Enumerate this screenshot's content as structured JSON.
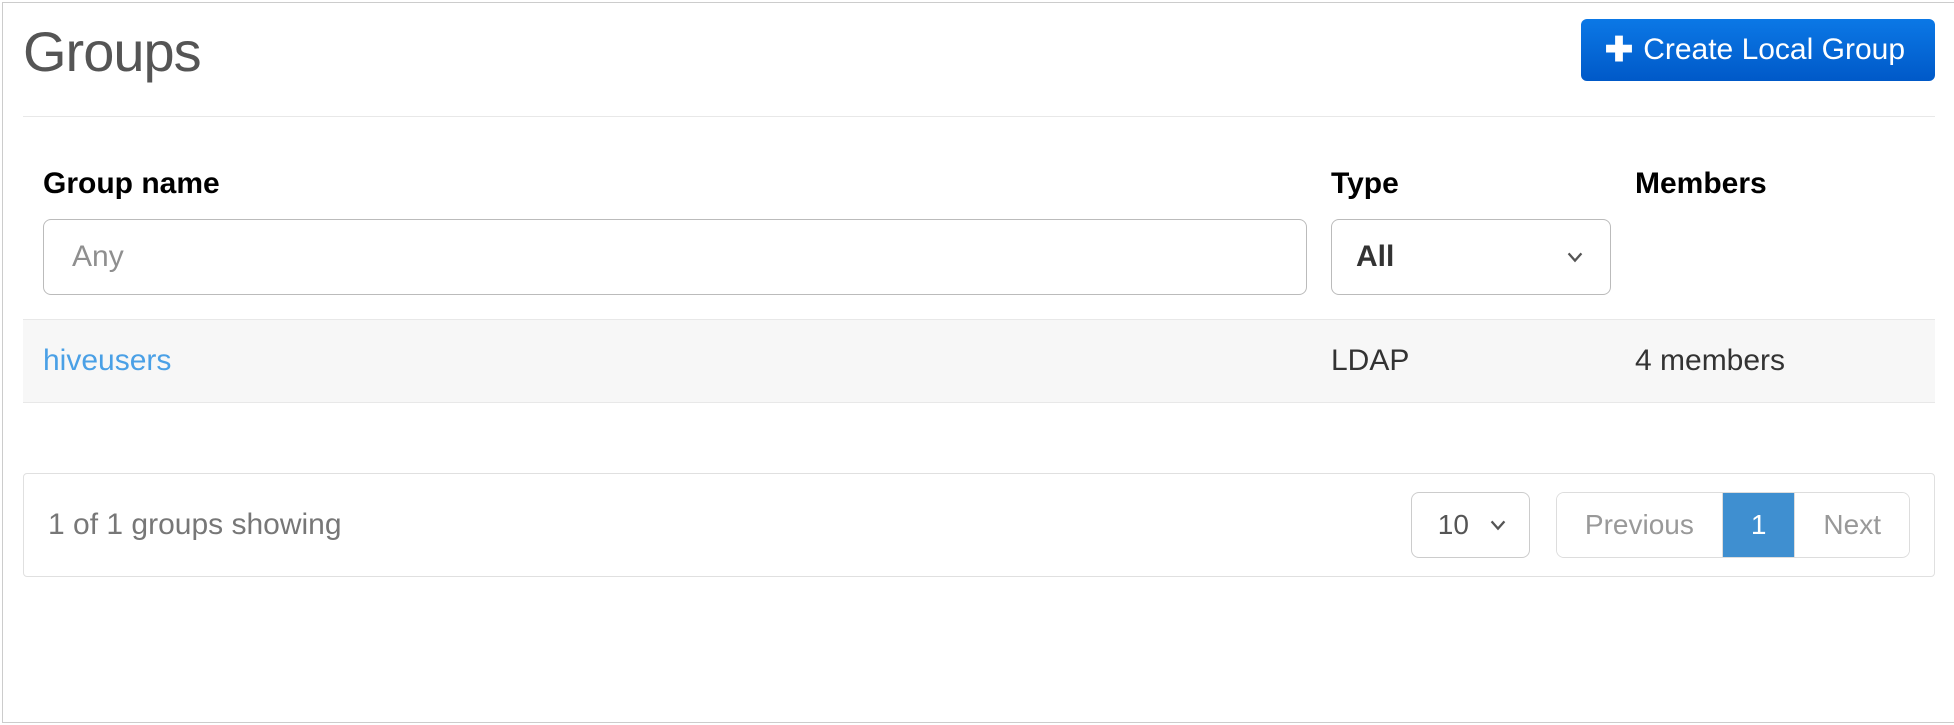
{
  "header": {
    "title": "Groups",
    "create_button": "Create Local Group"
  },
  "columns": {
    "name_label": "Group name",
    "type_label": "Type",
    "members_label": "Members",
    "name_filter_placeholder": "Any",
    "type_filter_selected": "All"
  },
  "rows": [
    {
      "name": "hiveusers",
      "type": "LDAP",
      "members": "4 members"
    }
  ],
  "footer": {
    "status": "1 of 1 groups showing",
    "page_size": "10",
    "prev_label": "Previous",
    "next_label": "Next",
    "current_page": "1"
  }
}
